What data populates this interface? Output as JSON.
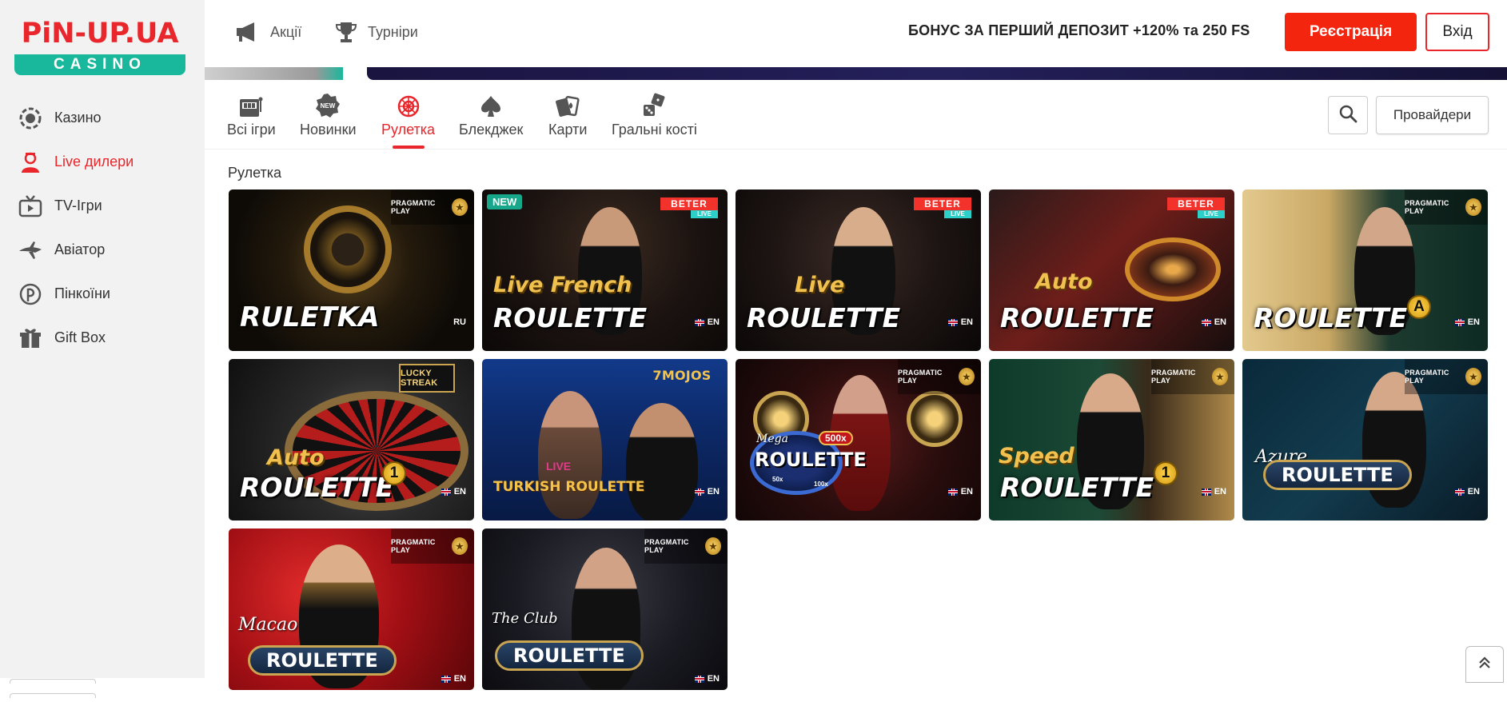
{
  "logo": {
    "top": "PiN-UP.UA",
    "bottom": "CASINO"
  },
  "sidebar": {
    "items": [
      {
        "label": "Казино",
        "icon": "chip-icon"
      },
      {
        "label": "Live дилери",
        "icon": "dealer-icon",
        "active": true
      },
      {
        "label": "TV-Ігри",
        "icon": "tv-icon"
      },
      {
        "label": "Авіатор",
        "icon": "plane-icon"
      },
      {
        "label": "Пінкоїни",
        "icon": "pincoin-icon"
      },
      {
        "label": "Gift Box",
        "icon": "gift-icon"
      }
    ]
  },
  "header": {
    "promos_label": "Акції",
    "tournaments_label": "Турніри",
    "bonus_text": "БОНУС ЗА ПЕРШИЙ ДЕПОЗИТ +120% та 250 FS",
    "register_label": "Реєстрація",
    "login_label": "Вхід"
  },
  "categories": [
    {
      "label": "Всі ігри",
      "icon": "slot-machine-icon"
    },
    {
      "label": "Новинки",
      "icon": "new-badge-icon"
    },
    {
      "label": "Рулетка",
      "icon": "roulette-icon",
      "active": true
    },
    {
      "label": "Блекджек",
      "icon": "spade-icon"
    },
    {
      "label": "Карти",
      "icon": "cards-icon"
    },
    {
      "label": "Гральні кості",
      "icon": "dice-icon"
    }
  ],
  "toolbar": {
    "providers_label": "Провайдери"
  },
  "section": {
    "title": "Рулетка"
  },
  "games": [
    {
      "top": "",
      "main": "RULETKA",
      "lang": "RU",
      "provider": "PRAGMATIC PLAY"
    },
    {
      "top": "Live French",
      "main": "ROULETTE",
      "lang": "EN",
      "provider": "BETER",
      "provider_sub": "LIVE",
      "badge": "NEW"
    },
    {
      "top": "Live",
      "main": "ROULETTE",
      "lang": "EN",
      "provider": "BETER",
      "provider_sub": "LIVE"
    },
    {
      "top": "Auto",
      "main": "ROULETTE",
      "lang": "EN",
      "provider": "BETER",
      "provider_sub": "LIVE"
    },
    {
      "top": "",
      "main": "ROULETTE",
      "lang": "EN",
      "provider": "PRAGMATIC PLAY",
      "marker": "A"
    },
    {
      "top": "Auto",
      "main": "ROULETTE",
      "lang": "EN",
      "provider": "LUCKY STREAK",
      "marker": "1"
    },
    {
      "top": "LIVE",
      "main": "TURKISH ROULETTE",
      "lang": "EN",
      "provider": "7MOJOS"
    },
    {
      "top": "Mega",
      "main": "ROULETTE",
      "lang": "EN",
      "provider": "PRAGMATIC PLAY",
      "multiplier": "500x",
      "mini_left": "50x",
      "mini_right": "100x"
    },
    {
      "top": "Speed",
      "main": "ROULETTE",
      "lang": "EN",
      "provider": "PRAGMATIC PLAY",
      "marker": "1"
    },
    {
      "top": "Azure",
      "main": "ROULETTE",
      "lang": "EN",
      "provider": "PRAGMATIC PLAY"
    },
    {
      "top": "Macao",
      "main": "ROULETTE",
      "lang": "EN",
      "provider": "PRAGMATIC PLAY"
    },
    {
      "top": "The Club",
      "main": "ROULETTE",
      "lang": "EN",
      "provider": "PRAGMATIC PLAY"
    }
  ],
  "colors": {
    "brand_red": "#e8262b",
    "accent_teal": "#19b79b",
    "register_bg": "#f3250f"
  }
}
